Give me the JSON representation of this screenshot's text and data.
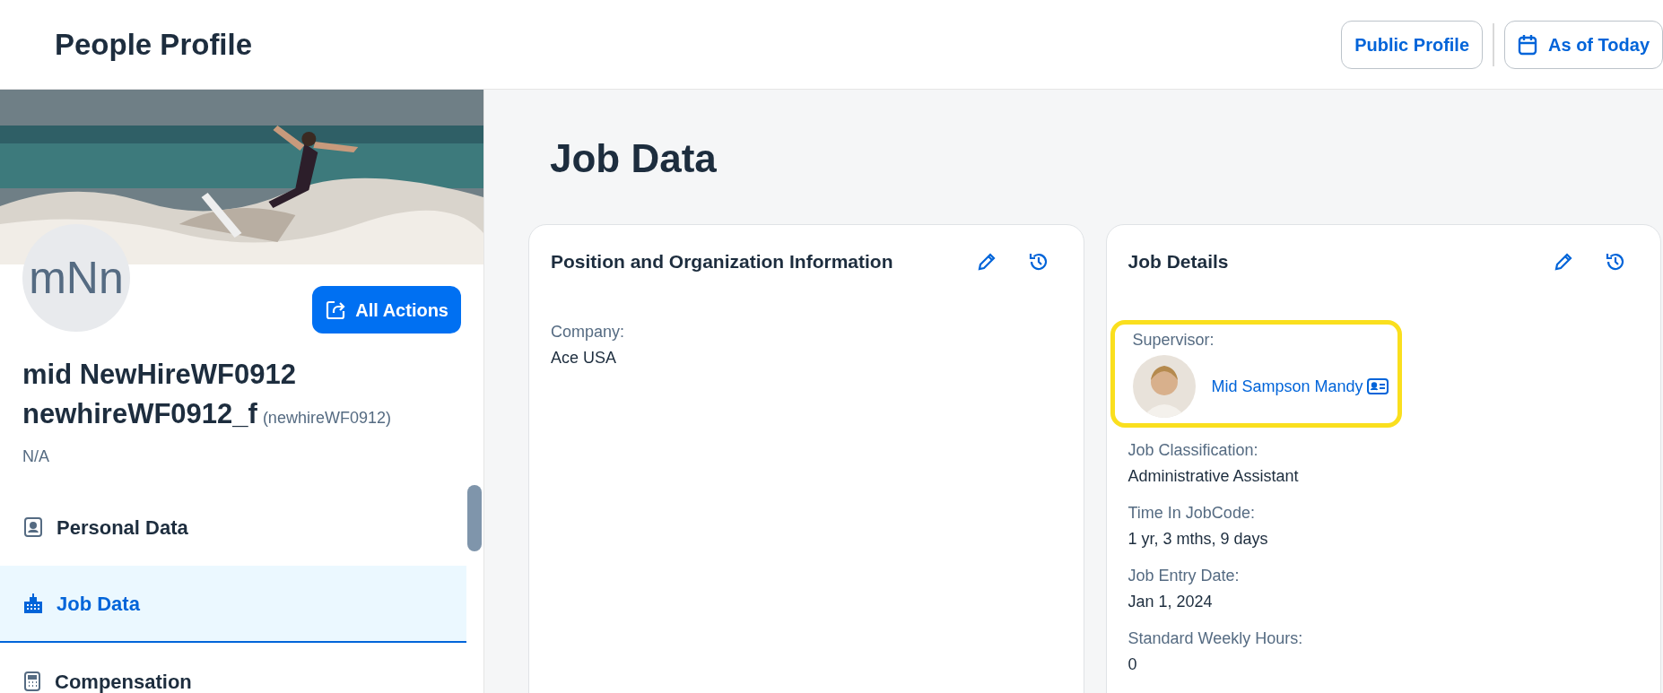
{
  "header": {
    "title": "People Profile",
    "buttons": [
      {
        "label": "Public Profile",
        "kind": "text"
      },
      {
        "label": "As of Today",
        "kind": "date"
      }
    ]
  },
  "profile": {
    "initials": "mNn",
    "actions_button": "All Actions",
    "name_lines": [
      "mid NewHireWF0912",
      "newhireWF0912_f"
    ],
    "username": "(newhireWF0912)",
    "subtitle": "N/A"
  },
  "nav": {
    "items": [
      {
        "label": "Personal Data",
        "selected": false
      },
      {
        "label": "Job Data",
        "selected": true
      },
      {
        "label": "Compensation",
        "selected": false
      }
    ]
  },
  "main": {
    "title": "Job Data",
    "cards": [
      {
        "title": "Position and Organization Information",
        "fields": [
          {
            "kind": "text",
            "label": "Company:",
            "value": "Ace USA"
          }
        ]
      },
      {
        "title": "Job Details",
        "fields": [
          {
            "kind": "person",
            "highlighted": true,
            "label": "Supervisor:",
            "value": "Mid Sampson Mandy"
          },
          {
            "kind": "text",
            "label": "Job Classification:",
            "value": "Administrative Assistant"
          },
          {
            "kind": "text",
            "label": "Time In JobCode:",
            "value": "1 yr, 3 mths, 9 days"
          },
          {
            "kind": "text",
            "label": "Job Entry Date:",
            "value": "Jan 1, 2024"
          },
          {
            "kind": "text",
            "label": "Standard Weekly Hours:",
            "value": "0"
          }
        ]
      }
    ]
  }
}
